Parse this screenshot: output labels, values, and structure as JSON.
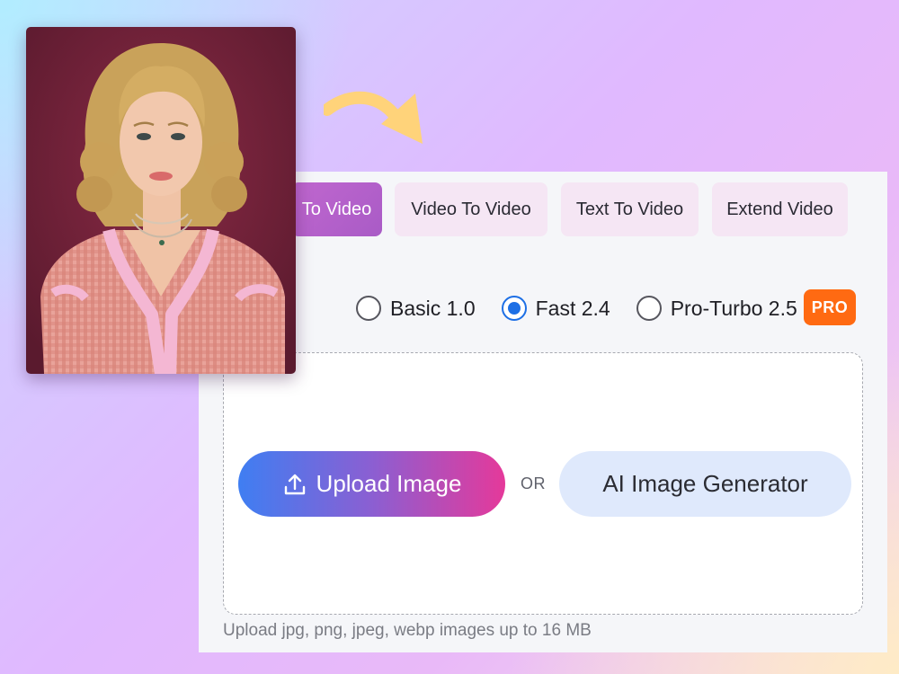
{
  "tabs": [
    {
      "label": "To Video",
      "active": true
    },
    {
      "label": "Video To Video",
      "active": false
    },
    {
      "label": "Text To Video",
      "active": false
    },
    {
      "label": "Extend Video",
      "active": false
    }
  ],
  "models": [
    {
      "label": "Basic 1.0",
      "checked": false
    },
    {
      "label": "Fast 2.4",
      "checked": true
    },
    {
      "label": "Pro-Turbo 2.5",
      "checked": false,
      "badge": "PRO"
    }
  ],
  "upload": {
    "upload_label": "Upload Image",
    "or_label": "OR",
    "generator_label": "AI Image Generator",
    "hint": "Upload jpg, png, jpeg, webp images up to 16 MB"
  },
  "colors": {
    "active_tab": "#b763cc",
    "radio_selected": "#1d6fe5",
    "pro_badge": "#ff6a12",
    "arrow": "#ffd37a"
  },
  "icons": {
    "upload": "upload-icon",
    "arrow": "curved-arrow-icon"
  }
}
